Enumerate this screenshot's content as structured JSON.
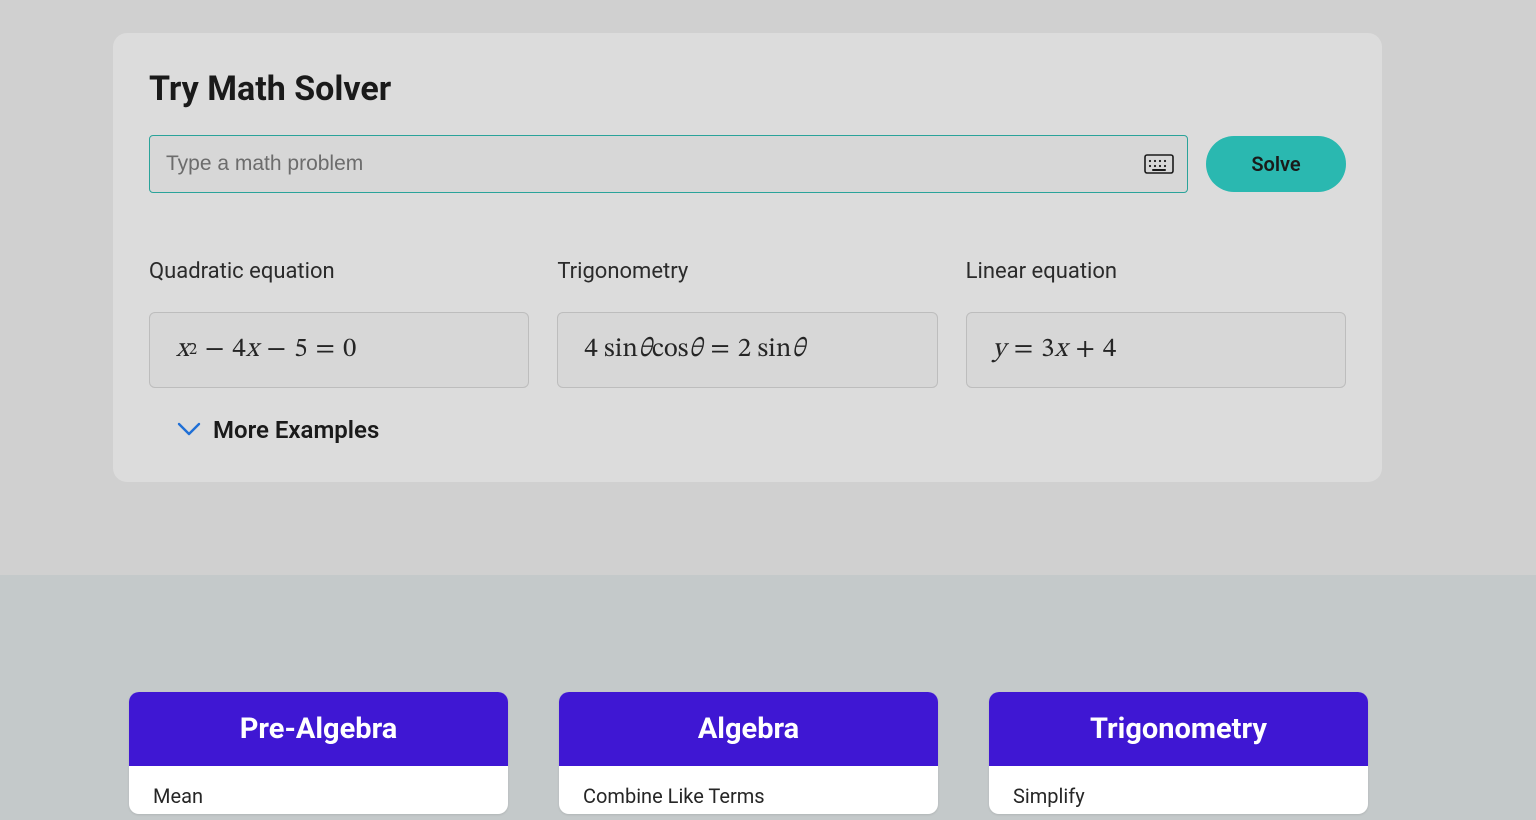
{
  "solver": {
    "title": "Try Math Solver",
    "input_placeholder": "Type a math problem",
    "solve_label": "Solve",
    "examples": [
      {
        "label": "Quadratic equation",
        "expr_html": "<span class='mvar'>x</span><sup>2</sup><span class='op'>−</span>4<span class='mvar'>x</span><span class='op'>−</span>5<span class='op'>=</span>0"
      },
      {
        "label": "Trigonometry",
        "expr_html": "4 sin <span class='mvar'>θ</span> cos <span class='mvar'>θ</span><span class='op'>=</span>2 sin <span class='mvar'>θ</span>"
      },
      {
        "label": "Linear equation",
        "expr_html": "<span class='mvar'>y</span><span class='op'>=</span>3<span class='mvar'>x</span><span class='op'>+</span>4"
      }
    ],
    "more_examples_label": "More Examples"
  },
  "topics": [
    {
      "title": "Pre-Algebra",
      "first_link": "Mean"
    },
    {
      "title": "Algebra",
      "first_link": "Combine Like Terms"
    },
    {
      "title": "Trigonometry",
      "first_link": "Simplify"
    }
  ]
}
